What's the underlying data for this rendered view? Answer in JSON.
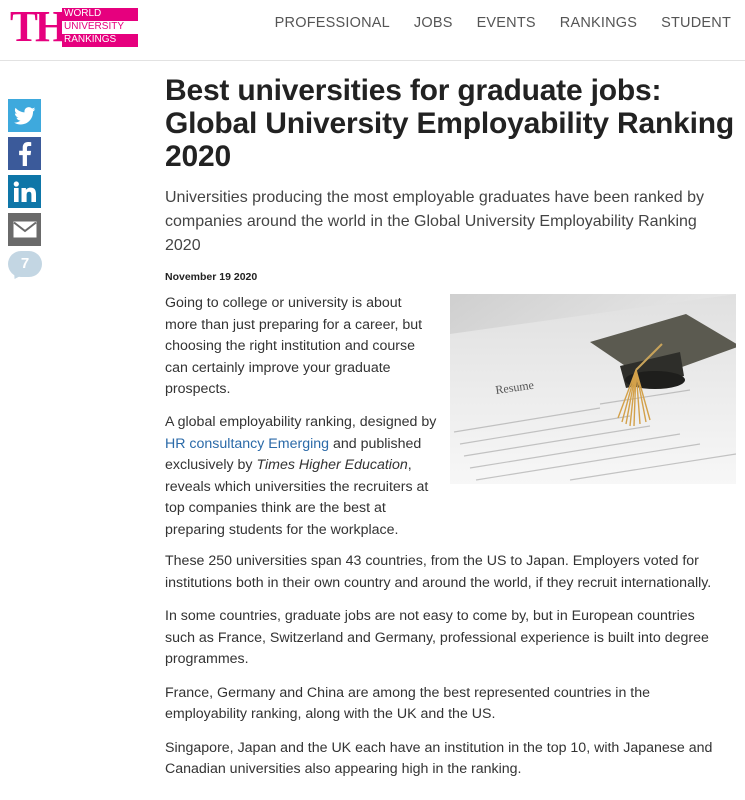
{
  "logo": {
    "letters": "THE",
    "line1": "WORLD",
    "line2": "UNIVERSITY",
    "line3": "RANKINGS"
  },
  "nav": {
    "items": [
      "PROFESSIONAL",
      "JOBS",
      "EVENTS",
      "RANKINGS",
      "STUDENT"
    ]
  },
  "share": {
    "comment_count": "7",
    "icons": [
      "twitter-icon",
      "facebook-icon",
      "linkedin-icon",
      "email-icon",
      "comment-icon"
    ]
  },
  "article": {
    "title": "Best universities for graduate jobs: Global University Employability Ranking 2020",
    "standfirst": "Universities producing the most employable graduates have been ranked by companies around the world in the Global University Employability Ranking 2020",
    "date": "November 19 2020",
    "p1": "Going to college or university is about more than just preparing for a career, but choosing the right institution and course can certainly improve your graduate prospects.",
    "p2_a": "A global employability ranking, designed by ",
    "p2_link": "HR consultancy Emerging",
    "p2_b": " and published exclusively by ",
    "p2_em": "Times Higher Education",
    "p2_c": ", reveals which universities the recruiters at top companies think are the best at preparing students for the workplace.",
    "p3": "These 250 universities span 43 countries, from the US to Japan. Employers voted for institutions both in their own country and around the world, if they recruit internationally.",
    "p4": "In some countries, graduate jobs are not easy to come by, but in European countries such as France, Switzerland and Germany, professional experience is built into degree programmes.",
    "p5": "France, Germany and China are among the best represented countries in the employability ranking, along with the UK and the US.",
    "p6": "Singapore, Japan and the UK each have an institution in the top 10, with Japanese and Canadian universities also appearing high in the ranking.",
    "image_resume_word": "Resume"
  },
  "colors": {
    "brand_pink": "#e6007e",
    "twitter": "#3ea9dd",
    "facebook": "#3b5a9a",
    "linkedin": "#0e76a8",
    "email": "#6a6a6a",
    "comment": "#c3d6e3",
    "link": "#2b6aa8"
  }
}
